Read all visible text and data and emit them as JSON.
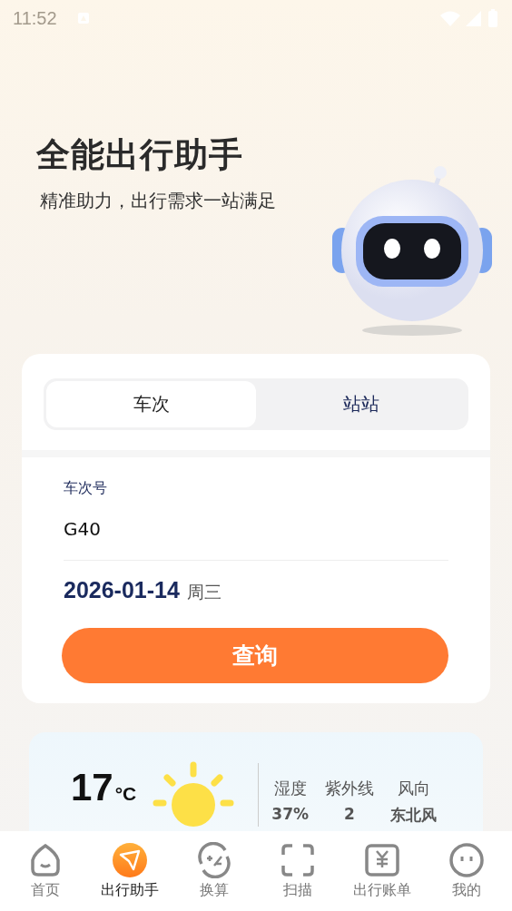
{
  "status_bar": {
    "time": "11:52"
  },
  "hero": {
    "title": "全能出行助手",
    "subtitle": "精准助力，出行需求一站满足"
  },
  "query": {
    "tabs": [
      {
        "label": "车次",
        "selected": true
      },
      {
        "label": "站站",
        "selected": false
      }
    ],
    "field": {
      "label": "车次号",
      "value": "G40"
    },
    "date": {
      "value": "2026-01-14",
      "weekday": "周三"
    },
    "button": "查询"
  },
  "weather": {
    "temperature": "17",
    "unit": "°C",
    "stats": [
      {
        "label": "湿度",
        "value": "37%"
      },
      {
        "label": "紫外线",
        "value": "2"
      },
      {
        "label": "风向",
        "value": "东北风"
      }
    ]
  },
  "bottom_nav": [
    {
      "label": "首页",
      "kind": "home",
      "selected": false
    },
    {
      "label": "出行助手",
      "kind": "plane",
      "selected": true
    },
    {
      "label": "换算",
      "kind": "convert",
      "selected": false
    },
    {
      "label": "扫描",
      "kind": "scan",
      "selected": false
    },
    {
      "label": "出行账单",
      "kind": "bill",
      "selected": false
    },
    {
      "label": "我的",
      "kind": "face",
      "selected": false
    }
  ]
}
